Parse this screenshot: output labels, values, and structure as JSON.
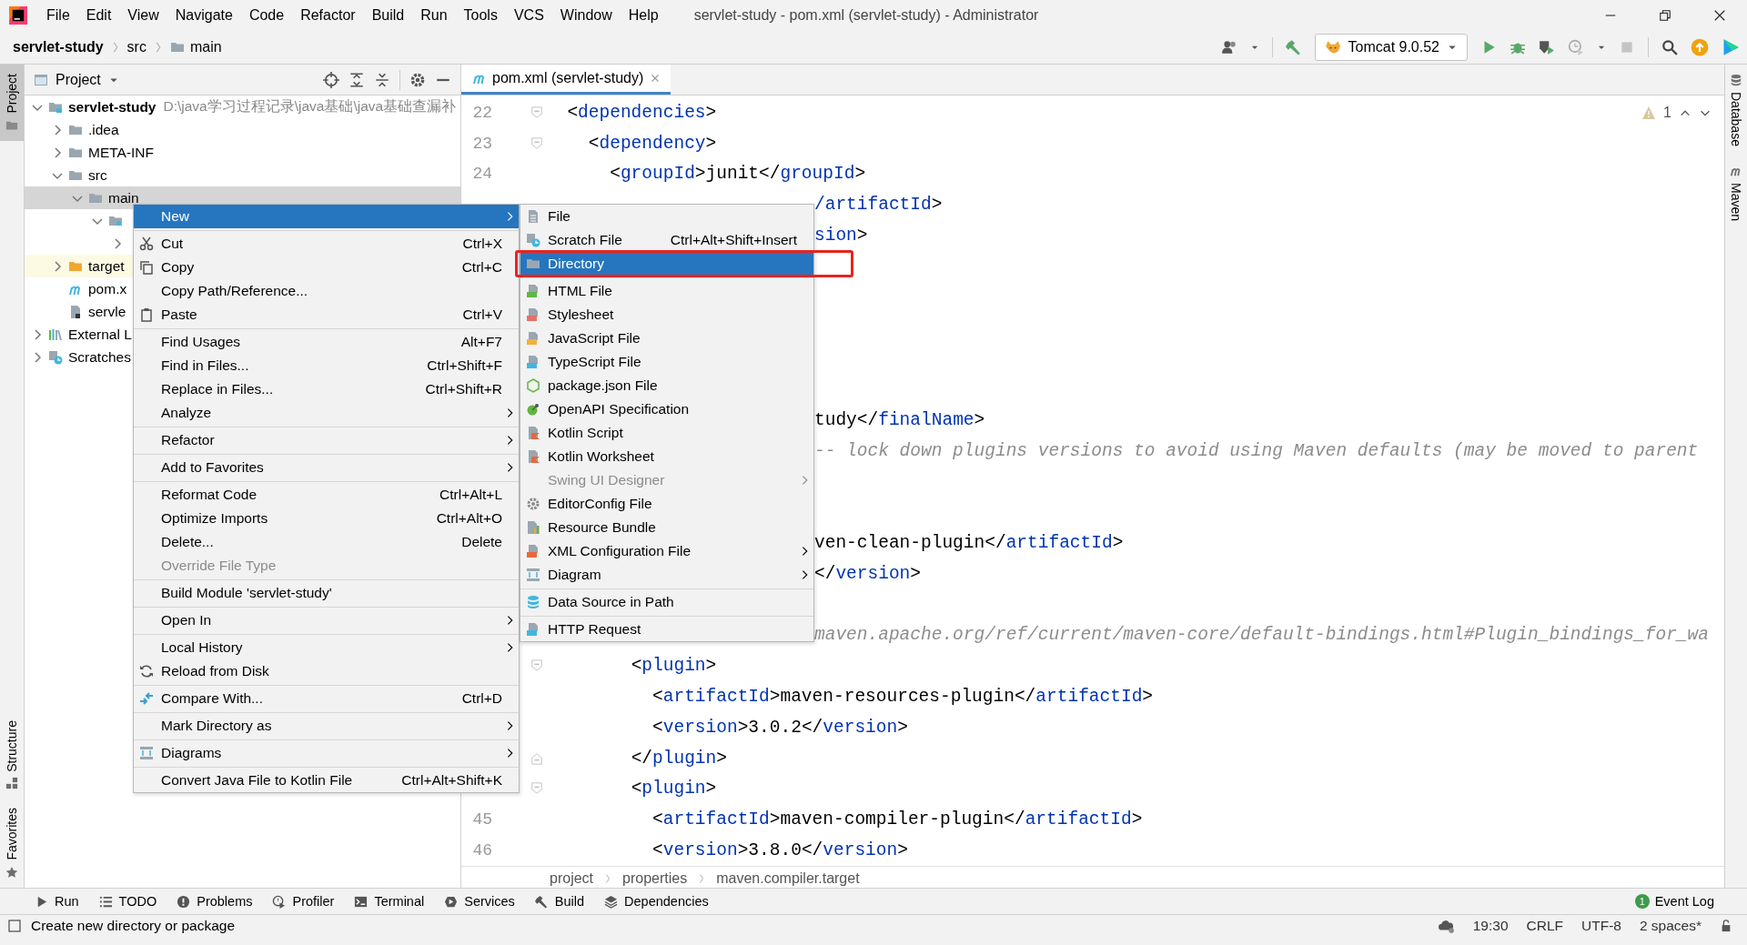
{
  "window": {
    "title": "servlet-study - pom.xml (servlet-study) - Administrator"
  },
  "menu_bar": [
    "File",
    "Edit",
    "View",
    "Navigate",
    "Code",
    "Refactor",
    "Build",
    "Run",
    "Tools",
    "VCS",
    "Window",
    "Help"
  ],
  "nav_bar": {
    "crumbs": [
      {
        "label": "servlet-study",
        "kind": "project"
      },
      {
        "label": "src",
        "kind": "plain"
      },
      {
        "label": "main",
        "kind": "folder"
      }
    ],
    "run_config": "Tomcat 9.0.52"
  },
  "left_strip": {
    "top": [
      {
        "label": "Project",
        "kind": "project",
        "selected": true
      }
    ],
    "bottom": [
      {
        "label": "Structure",
        "kind": "structure",
        "selected": false
      },
      {
        "label": "Favorites",
        "kind": "favorites",
        "selected": false
      }
    ]
  },
  "right_strip": [
    {
      "label": "Database",
      "kind": "database"
    },
    {
      "label": "Maven",
      "kind": "maven"
    }
  ],
  "project": {
    "title": "Project",
    "tree": [
      {
        "label": "servlet-study",
        "path": "D:\\java学习过程记录\\java基础\\java基础查漏补",
        "kind": "module",
        "expanded": true,
        "selected": false,
        "children": [
          {
            "label": ".idea",
            "kind": "folder",
            "expanded": false,
            "selected": false
          },
          {
            "label": "META-INF",
            "kind": "folder",
            "expanded": false,
            "selected": false
          },
          {
            "label": "src",
            "kind": "folder",
            "expanded": true,
            "selected": false,
            "children": [
              {
                "label": "main",
                "kind": "folder",
                "expanded": true,
                "selected": true,
                "children": [
                  {
                    "kind": "package",
                    "expanded": true,
                    "selected": false,
                    "children": [
                      {
                        "expanded": false,
                        "selected": false
                      }
                    ]
                  }
                ]
              }
            ]
          },
          {
            "label": "target",
            "kind": "excluded",
            "expanded": false,
            "selected": false
          },
          {
            "label": "pom.x",
            "kind": "maven",
            "selected": false
          },
          {
            "label": "servle",
            "kind": "file",
            "selected": false
          }
        ]
      },
      {
        "label": "External L",
        "kind": "libraries",
        "expanded": false,
        "selected": false
      },
      {
        "label": "Scratches",
        "kind": "scratches",
        "expanded": false,
        "selected": false
      }
    ]
  },
  "editor": {
    "tab": {
      "label": "pom.xml (servlet-study)",
      "selected": true
    },
    "warnings": "1",
    "lines": [
      {
        "number": "22",
        "kind": "foldopen",
        "text": "  <dependencies>"
      },
      {
        "number": "23",
        "kind": "foldopen",
        "text": "    <dependency>"
      },
      {
        "number": "24",
        "kind": "code",
        "text": "      <groupId>junit</groupId>"
      },
      {
        "kind": "cut",
        "text": "/artifactId>"
      },
      {
        "kind": "cut",
        "text": "sion>"
      },
      {
        "kind": "blank"
      },
      {
        "kind": "blank"
      },
      {
        "kind": "blank"
      },
      {
        "kind": "blank"
      },
      {
        "kind": "blank"
      },
      {
        "kind": "cut",
        "text": "tudy</finalName>"
      },
      {
        "kind": "cutcomment",
        "text": "-- lock down plugins versions to avoid using Maven defaults (may be moved to parent"
      },
      {
        "kind": "blank"
      },
      {
        "kind": "blank"
      },
      {
        "kind": "cut",
        "text": "ven-clean-plugin</artifactId>"
      },
      {
        "kind": "cut",
        "text": "</version>"
      },
      {
        "kind": "blank"
      },
      {
        "kind": "cutcomment",
        "text": "maven.apache.org/ref/current/maven-core/default-bindings.html#Plugin_bindings_for_wa"
      },
      {
        "kind": "foldopen",
        "text": "        <plugin>"
      },
      {
        "kind": "code",
        "text": "          <artifactId>maven-resources-plugin</artifactId>"
      },
      {
        "kind": "code",
        "text": "          <version>3.0.2</version>"
      },
      {
        "kind": "foldclose",
        "text": "        </plugin>"
      },
      {
        "kind": "foldopen",
        "text": "        <plugin>"
      },
      {
        "number": "45",
        "kind": "code",
        "text": "          <artifactId>maven-compiler-plugin</artifactId>"
      },
      {
        "number": "46",
        "kind": "code",
        "text": "          <version>3.8.0</version>"
      }
    ],
    "breadcrumbs": [
      "project",
      "properties",
      "maven.compiler.target"
    ]
  },
  "context_menu": {
    "groups": [
      [
        {
          "label": "New",
          "kind": "plain",
          "submenu": true,
          "selected": true,
          "disabled": false
        }
      ],
      [
        {
          "label": "Cut",
          "kind": "cut",
          "shortcut": "Ctrl+X",
          "selected": false,
          "disabled": false
        },
        {
          "label": "Copy",
          "kind": "copy",
          "shortcut": "Ctrl+C",
          "selected": false,
          "disabled": false
        },
        {
          "label": "Copy Path/Reference...",
          "kind": "plain",
          "selected": false,
          "disabled": false
        },
        {
          "label": "Paste",
          "kind": "paste",
          "shortcut": "Ctrl+V",
          "selected": false,
          "disabled": false
        }
      ],
      [
        {
          "label": "Find Usages",
          "kind": "plain",
          "shortcut": "Alt+F7",
          "selected": false,
          "disabled": false
        },
        {
          "label": "Find in Files...",
          "kind": "plain",
          "shortcut": "Ctrl+Shift+F",
          "selected": false,
          "disabled": false
        },
        {
          "label": "Replace in Files...",
          "kind": "plain",
          "shortcut": "Ctrl+Shift+R",
          "selected": false,
          "disabled": false
        },
        {
          "label": "Analyze",
          "kind": "plain",
          "submenu": true,
          "selected": false,
          "disabled": false
        }
      ],
      [
        {
          "label": "Refactor",
          "kind": "plain",
          "submenu": true,
          "selected": false,
          "disabled": false
        }
      ],
      [
        {
          "label": "Add to Favorites",
          "kind": "plain",
          "submenu": true,
          "selected": false,
          "disabled": false
        }
      ],
      [
        {
          "label": "Reformat Code",
          "kind": "plain",
          "shortcut": "Ctrl+Alt+L",
          "selected": false,
          "disabled": false
        },
        {
          "label": "Optimize Imports",
          "kind": "plain",
          "shortcut": "Ctrl+Alt+O",
          "selected": false,
          "disabled": false
        },
        {
          "label": "Delete...",
          "kind": "plain",
          "shortcut": "Delete",
          "selected": false,
          "disabled": false
        },
        {
          "label": "Override File Type",
          "kind": "plain",
          "selected": false,
          "disabled": true
        }
      ],
      [
        {
          "label": "Build Module 'servlet-study'",
          "kind": "plain",
          "selected": false,
          "disabled": false
        }
      ],
      [
        {
          "label": "Open In",
          "kind": "plain",
          "submenu": true,
          "selected": false,
          "disabled": false
        }
      ],
      [
        {
          "label": "Local History",
          "kind": "plain",
          "submenu": true,
          "selected": false,
          "disabled": false
        },
        {
          "label": "Reload from Disk",
          "kind": "reload",
          "selected": false,
          "disabled": false
        }
      ],
      [
        {
          "label": "Compare With...",
          "kind": "compare",
          "shortcut": "Ctrl+D",
          "selected": false,
          "disabled": false
        }
      ],
      [
        {
          "label": "Mark Directory as",
          "kind": "plain",
          "submenu": true,
          "selected": false,
          "disabled": false
        }
      ],
      [
        {
          "label": "Diagrams",
          "kind": "diagram",
          "submenu": true,
          "selected": false,
          "disabled": false
        }
      ],
      [
        {
          "label": "Convert Java File to Kotlin File",
          "kind": "plain",
          "shortcut": "Ctrl+Alt+Shift+K",
          "selected": false,
          "disabled": false
        }
      ]
    ]
  },
  "submenu": {
    "groups": [
      [
        {
          "label": "File",
          "kind": "file",
          "selected": false,
          "disabled": false
        },
        {
          "label": "Scratch File",
          "kind": "scratch",
          "shortcut": "Ctrl+Alt+Shift+Insert",
          "selected": false,
          "disabled": false
        },
        {
          "label": "Directory",
          "kind": "directory",
          "selected": true,
          "disabled": false,
          "outlined": true
        }
      ],
      [
        {
          "label": "HTML File",
          "kind": "html",
          "selected": false,
          "disabled": false
        },
        {
          "label": "Stylesheet",
          "kind": "css",
          "selected": false,
          "disabled": false
        },
        {
          "label": "JavaScript File",
          "kind": "js",
          "selected": false,
          "disabled": false
        },
        {
          "label": "TypeScript File",
          "kind": "ts",
          "selected": false,
          "disabled": false
        },
        {
          "label": "package.json File",
          "kind": "package",
          "selected": false,
          "disabled": false
        },
        {
          "label": "OpenAPI Specification",
          "kind": "openapi",
          "selected": false,
          "disabled": false
        },
        {
          "label": "Kotlin Script",
          "kind": "kotlin",
          "selected": false,
          "disabled": false
        },
        {
          "label": "Kotlin Worksheet",
          "kind": "kotlin",
          "selected": false,
          "disabled": false
        },
        {
          "label": "Swing UI Designer",
          "kind": "plain",
          "submenu": true,
          "selected": false,
          "disabled": true
        },
        {
          "label": "EditorConfig File",
          "kind": "config",
          "selected": false,
          "disabled": false
        },
        {
          "label": "Resource Bundle",
          "kind": "bundle",
          "selected": false,
          "disabled": false
        },
        {
          "label": "XML Configuration File",
          "kind": "xml",
          "submenu": true,
          "selected": false,
          "disabled": false
        },
        {
          "label": "Diagram",
          "kind": "diagram",
          "submenu": true,
          "selected": false,
          "disabled": false
        }
      ],
      [
        {
          "label": "Data Source in Path",
          "kind": "datasource",
          "selected": false,
          "disabled": false
        }
      ],
      [
        {
          "label": "HTTP Request",
          "kind": "http",
          "selected": false,
          "disabled": false
        }
      ]
    ]
  },
  "tool_bar": {
    "tools": [
      {
        "label": "Run",
        "kind": "run"
      },
      {
        "label": "TODO",
        "kind": "todo"
      },
      {
        "label": "Problems",
        "kind": "problems"
      },
      {
        "label": "Profiler",
        "kind": "profiler"
      },
      {
        "label": "Terminal",
        "kind": "terminal"
      },
      {
        "label": "Services",
        "kind": "services"
      },
      {
        "label": "Build",
        "kind": "build"
      },
      {
        "label": "Dependencies",
        "kind": "dependencies"
      }
    ],
    "event_log": {
      "label": "Event Log",
      "badge": "1"
    }
  },
  "status_bar": {
    "message": "Create new directory or package",
    "items": [
      "19:30",
      "CRLF",
      "UTF-8",
      "2 spaces*"
    ]
  }
}
